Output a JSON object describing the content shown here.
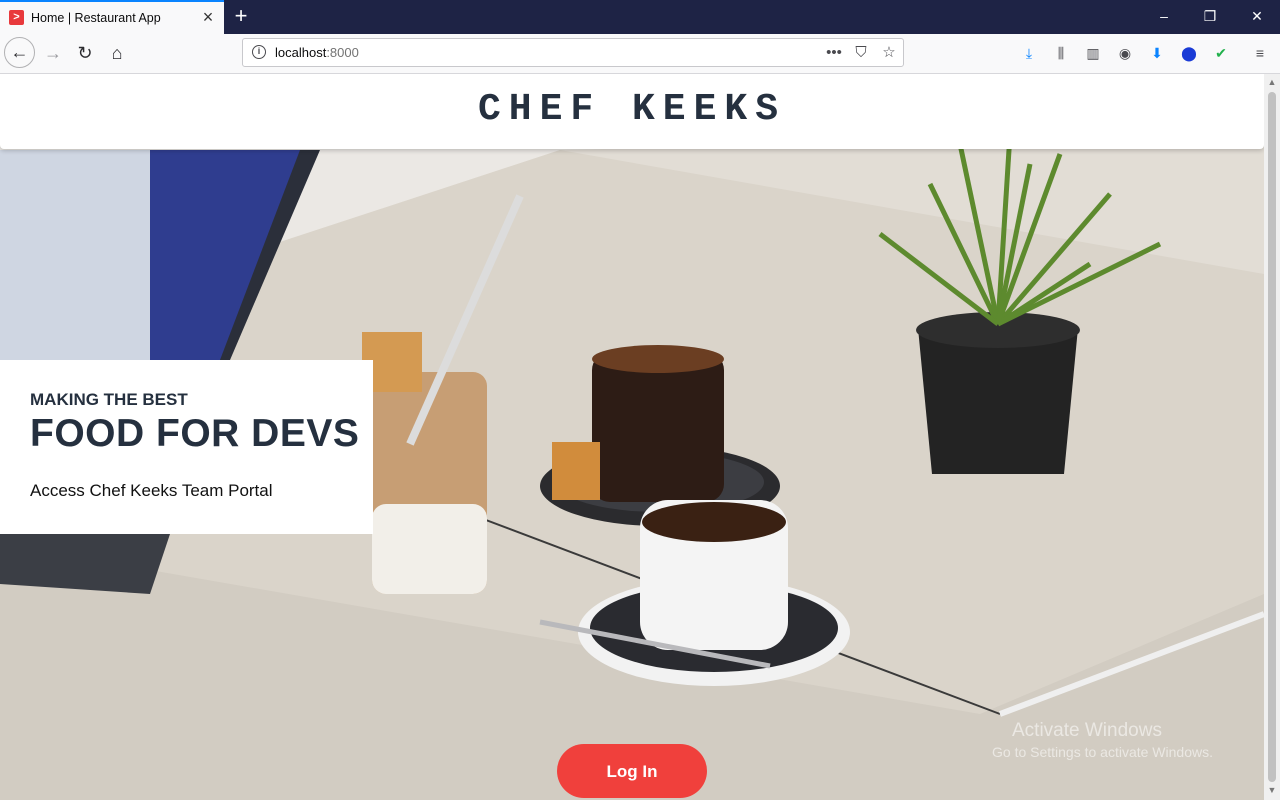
{
  "browser": {
    "tab_title": "Home | Restaurant App",
    "url_host": "localhost",
    "url_port": ":8000",
    "window_controls": {
      "minimize": "–",
      "restore": "❐",
      "close": "✕"
    }
  },
  "site": {
    "title": "CHEF KEEKS"
  },
  "hero": {
    "kicker": "MAKING THE BEST",
    "heading": "FOOD FOR DEVS",
    "subtitle": "Access Chef Keeks Team Portal",
    "login_label": "Log In"
  },
  "os_watermark": {
    "line1": "Activate Windows",
    "line2": "Go to Settings to activate Windows."
  },
  "colors": {
    "accent": "#f0403c",
    "text_dark": "#25303f",
    "chrome_dark": "#1e2345"
  },
  "icons": [
    "back-arrow-icon",
    "forward-arrow-icon",
    "reload-icon",
    "home-icon",
    "info-icon",
    "more-icon",
    "pocket-icon",
    "bookmark-star-icon",
    "download-icon",
    "library-icon",
    "sidebar-icon",
    "account-icon",
    "extension-download-icon",
    "extension-blue-icon",
    "extension-green-check-icon",
    "menu-icon"
  ]
}
